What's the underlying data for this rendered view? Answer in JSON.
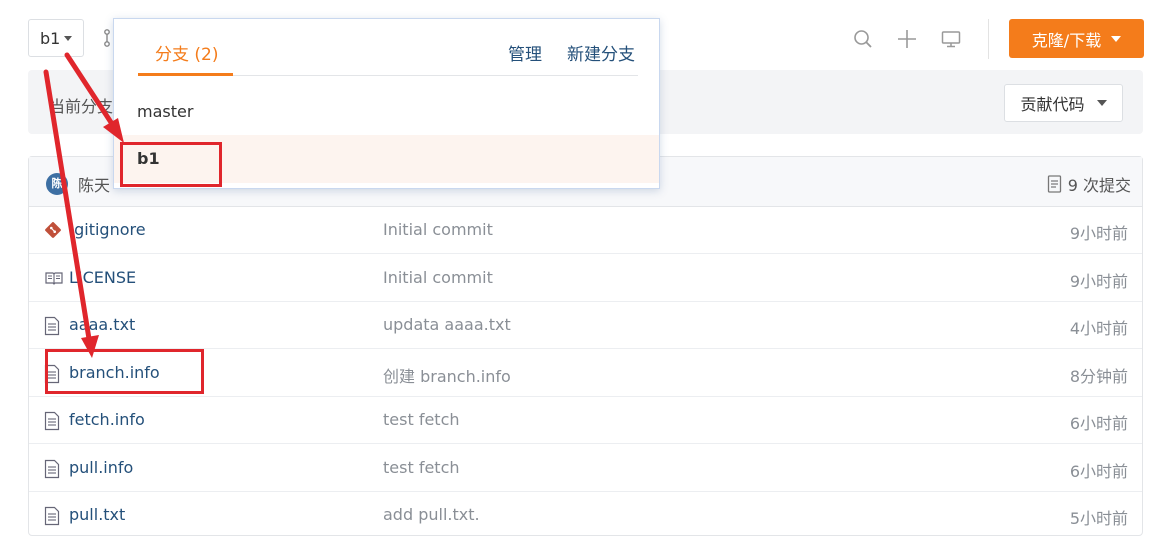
{
  "toolbar": {
    "branch_label": "b1",
    "clone_label": "克隆/下载"
  },
  "icons": {
    "branch_graph": "branch-graph-icon",
    "search": "search-icon",
    "add": "plus-icon",
    "monitor": "monitor-icon",
    "file": "file-icon",
    "commits": "commit-list-icon"
  },
  "current_bar": {
    "label": "当前分支",
    "contribute_label": "贡献代码"
  },
  "table": {
    "avatar_text": "陈",
    "author": "陈天",
    "commit_count_label": "9 次提交",
    "files": [
      {
        "name": ".gitignore",
        "message": "Initial commit",
        "time": "9小时前",
        "icon": "git-icon"
      },
      {
        "name": "LICENSE",
        "message": "Initial commit",
        "time": "9小时前",
        "icon": "book-icon"
      },
      {
        "name": "aaaa.txt",
        "message": "updata aaaa.txt",
        "time": "4小时前",
        "icon": "file-icon"
      },
      {
        "name": "branch.info",
        "message": "创建 branch.info",
        "time": "8分钟前",
        "icon": "file-icon"
      },
      {
        "name": "fetch.info",
        "message": "test fetch",
        "time": "6小时前",
        "icon": "file-icon"
      },
      {
        "name": "pull.info",
        "message": "test fetch",
        "time": "6小时前",
        "icon": "file-icon"
      },
      {
        "name": "pull.txt",
        "message": "add pull.txt.",
        "time": "5小时前",
        "icon": "file-icon"
      }
    ]
  },
  "dropdown": {
    "tab_label": "分支 (2)",
    "manage_label": "管理",
    "new_branch_label": "新建分支",
    "branches": [
      "master",
      "b1"
    ]
  },
  "colors": {
    "accent": "#f47c1b",
    "link": "#24507a",
    "annotation": "#e0262c"
  }
}
